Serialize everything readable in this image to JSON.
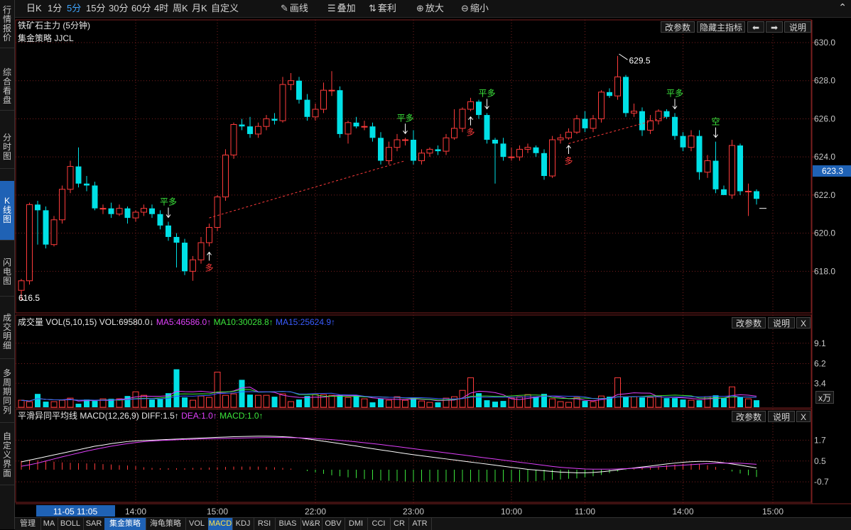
{
  "sidebar": [
    {
      "label": "行情报价",
      "top": 0,
      "h": 68,
      "active": false
    },
    {
      "label": "综合看盘",
      "top": 88,
      "h": 68,
      "active": false
    },
    {
      "label": "分时图",
      "top": 178,
      "h": 60,
      "active": false
    },
    {
      "label": "K线图",
      "top": 255,
      "h": 84,
      "active": true
    },
    {
      "label": "闪电图",
      "top": 350,
      "h": 68,
      "active": false
    },
    {
      "label": "成交明细",
      "top": 430,
      "h": 76,
      "active": false
    },
    {
      "label": "多周期同列",
      "top": 510,
      "h": 86,
      "active": false
    },
    {
      "label": "自定义界面",
      "top": 600,
      "h": 84,
      "active": false
    }
  ],
  "toolbar": {
    "periods": [
      "日K",
      "1分",
      "5分",
      "15分",
      "30分",
      "60分",
      "4时",
      "周K",
      "月K",
      "自定义"
    ],
    "selected_period": "5分",
    "tools": [
      {
        "icon": "pen-icon",
        "glyph": "✎",
        "label": "画线"
      },
      {
        "icon": "stack-icon",
        "glyph": "☰",
        "label": "叠加"
      },
      {
        "icon": "arbitrage-icon",
        "glyph": "⇅",
        "label": "套利"
      },
      {
        "icon": "zoom-in-icon",
        "glyph": "⊕",
        "label": "放大"
      },
      {
        "icon": "zoom-out-icon",
        "glyph": "⊖",
        "label": "缩小"
      }
    ]
  },
  "main_panel": {
    "title": "铁矿石主力 (5分钟)",
    "strategy": "集金策略 JJCL",
    "buttons": {
      "params": "改参数",
      "hide": "隐藏主指标",
      "left_glyph": "⬅",
      "right_glyph": "➡",
      "help": "说明"
    },
    "current_price": "623.3",
    "high_label": "629.5",
    "low_label": "616.5"
  },
  "vol_panel": {
    "title": "成交量",
    "params": "VOL(5,10,15)",
    "vol_text": "VOL:69580.0↓",
    "ma5_text": "MA5:46586.0↑",
    "ma10_text": "MA10:30028.8↑",
    "ma15_text": "MA15:25624.9↑",
    "unit": "x万",
    "buttons": {
      "params": "改参数",
      "help": "说明",
      "close": "X"
    },
    "ticks": [
      "9.1",
      "6.2",
      "3.4"
    ]
  },
  "macd_panel": {
    "title": "平滑异同平均线",
    "params": "MACD(12,26,9)",
    "diff_text": "DIFF:1.5↑",
    "dea_text": "DEA:1.0↑",
    "macd_text": "MACD:1.0↑",
    "buttons": {
      "params": "改参数",
      "help": "说明",
      "close": "X"
    },
    "ticks": [
      "1.7",
      "0.5",
      "-0.7"
    ]
  },
  "signals": [
    {
      "label": "平多",
      "index": 18,
      "kind": "buy_exit"
    },
    {
      "label": "多",
      "index": 23,
      "kind": "buy"
    },
    {
      "label": "平多",
      "index": 47,
      "kind": "buy_exit"
    },
    {
      "label": "多",
      "index": 55,
      "kind": "buy"
    },
    {
      "label": "平多",
      "index": 57,
      "kind": "buy_exit"
    },
    {
      "label": "多",
      "index": 67,
      "kind": "buy"
    },
    {
      "label": "平多",
      "index": 80,
      "kind": "buy_exit"
    },
    {
      "label": "空",
      "index": 85,
      "kind": "sell"
    }
  ],
  "colors": {
    "up": "#ff3b3b",
    "down": "#00e0e6",
    "grid": "#7a1f1f",
    "axis": "#c8c8c8",
    "ma5": "#ffffff",
    "ma10": "#ffd400",
    "ma15": "#e040fb",
    "diff": "#ffffff",
    "dea": "#e040fb",
    "macd_up": "#ff3b3b",
    "macd_down": "#3ce63c",
    "signal_green": "#3ce63c",
    "signal_red": "#ff3b3b"
  },
  "chart_data": {
    "type": "candlestick",
    "y_ticks": [
      630,
      628,
      626,
      624,
      622,
      620,
      618
    ],
    "ylim": [
      616,
      630.2
    ],
    "x_ticks": [
      {
        "i": 0,
        "label": "11-05 11:05",
        "highlight": true
      },
      {
        "i": 14,
        "label": "14:00"
      },
      {
        "i": 24,
        "label": "15:00"
      },
      {
        "i": 36,
        "label": "22:00"
      },
      {
        "i": 48,
        "label": "23:00"
      },
      {
        "i": 60,
        "label": "10:00"
      },
      {
        "i": 69,
        "label": "11:00"
      },
      {
        "i": 81,
        "label": "14:00"
      },
      {
        "i": 92,
        "label": "15:00"
      }
    ],
    "open": [
      617.0,
      617.5,
      621.5,
      621.2,
      619.4,
      620.7,
      622.3,
      623.5,
      622.6,
      622.5,
      621.3,
      621.3,
      621.0,
      621.3,
      620.8,
      621.1,
      621.3,
      621.0,
      620.4,
      619.8,
      619.5,
      618.0,
      618.6,
      619.5,
      620.3,
      621.9,
      624.1,
      625.7,
      625.6,
      625.2,
      625.6,
      626.0,
      625.9,
      627.8,
      628.0,
      627.0,
      626.1,
      626.5,
      627.5,
      627.5,
      625.2,
      625.8,
      625.6,
      625.6,
      625.0,
      623.8,
      624.5,
      624.9,
      624.9,
      623.8,
      624.2,
      624.4,
      624.3,
      625.0,
      625.5,
      626.5,
      626.9,
      626.2,
      624.9,
      624.7,
      624.0,
      624.0,
      624.4,
      624.5,
      624.2,
      623.0,
      624.9,
      625.0,
      625.3,
      626.0,
      625.5,
      626.0,
      627.4,
      627.2,
      628.2,
      626.3,
      626.4,
      625.4,
      625.9,
      626.4,
      626.1,
      625.1,
      624.5,
      625.1,
      623.2,
      623.8,
      622.3,
      622.0,
      624.6,
      622.2,
      622.2
    ],
    "close": [
      617.5,
      621.5,
      621.2,
      619.4,
      620.7,
      622.3,
      623.5,
      622.6,
      622.5,
      621.3,
      621.3,
      621.0,
      621.3,
      620.8,
      621.1,
      621.3,
      621.0,
      620.4,
      619.8,
      619.5,
      618.0,
      618.6,
      619.5,
      620.3,
      621.9,
      624.1,
      625.7,
      625.6,
      625.2,
      625.6,
      626.0,
      625.9,
      627.8,
      628.0,
      627.0,
      626.1,
      626.5,
      627.5,
      627.5,
      625.2,
      625.8,
      625.6,
      625.6,
      625.0,
      623.8,
      624.5,
      624.9,
      624.9,
      623.8,
      624.2,
      624.4,
      624.3,
      625.0,
      625.5,
      626.5,
      626.9,
      626.2,
      624.9,
      624.7,
      624.0,
      624.0,
      624.4,
      624.5,
      624.2,
      623.0,
      624.9,
      625.0,
      625.3,
      626.0,
      625.5,
      626.0,
      627.4,
      627.2,
      628.2,
      626.3,
      626.4,
      625.4,
      625.9,
      626.4,
      626.1,
      625.1,
      624.5,
      625.1,
      623.2,
      623.8,
      622.3,
      622.0,
      624.6,
      622.2,
      622.2,
      621.8
    ],
    "high": [
      617.6,
      621.6,
      621.7,
      621.4,
      620.9,
      622.5,
      623.8,
      624.5,
      623.0,
      622.7,
      621.5,
      621.6,
      621.5,
      621.4,
      621.2,
      621.5,
      621.5,
      621.2,
      620.6,
      620.0,
      619.7,
      618.8,
      619.8,
      620.5,
      622.0,
      624.4,
      625.8,
      626.0,
      626.1,
      625.8,
      626.2,
      626.3,
      628.2,
      628.4,
      628.2,
      627.3,
      626.8,
      627.9,
      628.5,
      627.7,
      625.9,
      626.1,
      625.9,
      625.8,
      625.3,
      624.8,
      625.2,
      625.0,
      625.4,
      624.4,
      624.5,
      624.6,
      625.2,
      626.5,
      626.6,
      627.1,
      627.0,
      626.3,
      625.0,
      625.0,
      624.5,
      624.6,
      624.7,
      624.6,
      624.4,
      625.1,
      625.2,
      625.5,
      626.2,
      626.4,
      626.2,
      627.5,
      627.6,
      629.3,
      628.3,
      626.8,
      626.6,
      626.2,
      626.5,
      626.5,
      626.3,
      625.3,
      625.4,
      625.4,
      624.1,
      624.8,
      622.5,
      624.9,
      624.7,
      622.6,
      622.3
    ],
    "low": [
      616.5,
      617.3,
      619.4,
      619.2,
      619.3,
      620.5,
      622.1,
      622.4,
      622.2,
      621.2,
      621.0,
      620.8,
      620.9,
      620.5,
      620.6,
      620.9,
      620.8,
      620.2,
      619.6,
      618.2,
      617.8,
      617.5,
      618.4,
      619.3,
      620.1,
      621.7,
      623.9,
      625.4,
      625.0,
      625.0,
      625.4,
      625.7,
      625.8,
      627.5,
      626.8,
      625.9,
      625.9,
      626.3,
      627.2,
      625.0,
      624.7,
      625.5,
      625.4,
      624.8,
      623.6,
      623.6,
      624.3,
      624.6,
      623.6,
      623.6,
      624.0,
      624.1,
      624.1,
      624.9,
      625.3,
      626.4,
      626.0,
      624.7,
      622.6,
      623.8,
      623.8,
      623.8,
      624.2,
      624.0,
      622.8,
      622.9,
      624.7,
      624.9,
      625.2,
      625.3,
      625.3,
      625.8,
      627.1,
      627.0,
      626.1,
      626.1,
      625.1,
      625.2,
      625.7,
      626.0,
      624.9,
      624.3,
      624.3,
      622.8,
      622.9,
      622.1,
      622.0,
      621.8,
      622.0,
      620.9,
      621.5
    ],
    "volume_x10k": [
      1.0,
      0.8,
      1.9,
      0.8,
      0.8,
      1.0,
      1.3,
      0.5,
      1.1,
      0.9,
      1.2,
      1.2,
      1.2,
      1.6,
      2.2,
      1.7,
      1.1,
      1.2,
      2.0,
      5.4,
      1.4,
      1.0,
      1.6,
      1.4,
      5.0,
      1.7,
      1.9,
      3.9,
      1.8,
      1.7,
      1.7,
      1.5,
      1.9,
      0.8,
      1.1,
      1.6,
      1.8,
      1.8,
      1.7,
      1.7,
      1.4,
      1.7,
      1.2,
      0.7,
      1.2,
      1.0,
      1.5,
      1.0,
      1.3,
      0.9,
      0.7,
      0.7,
      1.3,
      1.5,
      2.4,
      4.2,
      2.0,
      1.0,
      0.8,
      0.9,
      1.3,
      1.5,
      1.8,
      1.5,
      1.9,
      1.2,
      0.8,
      0.7,
      1.4,
      0.9,
      0.8,
      1.6,
      1.5,
      4.2,
      1.5,
      1.5,
      1.4,
      1.4,
      1.6,
      1.3,
      1.3,
      1.1,
      1.0,
      1.0,
      1.5,
      1.7,
      1.3,
      2.9,
      1.5,
      1.2,
      1.0
    ],
    "macd_diff": [
      0.45,
      0.55,
      0.65,
      0.75,
      0.85,
      0.95,
      1.05,
      1.15,
      1.25,
      1.35,
      1.42,
      1.5,
      1.56,
      1.62,
      1.66,
      1.68,
      1.7,
      1.72,
      1.74,
      1.76,
      1.78,
      1.8,
      1.82,
      1.84,
      1.86,
      1.88,
      1.9,
      1.91,
      1.92,
      1.93,
      1.93,
      1.92,
      1.9,
      1.87,
      1.83,
      1.77,
      1.71,
      1.64,
      1.57,
      1.5,
      1.43,
      1.36,
      1.28,
      1.21,
      1.14,
      1.07,
      1.0,
      0.93,
      0.86,
      0.8,
      0.74,
      0.68,
      0.62,
      0.56,
      0.5,
      0.44,
      0.38,
      0.32,
      0.26,
      0.2,
      0.14,
      0.08,
      0.02,
      -0.02,
      -0.06,
      -0.1,
      -0.14,
      -0.16,
      -0.18,
      -0.18,
      -0.16,
      -0.12,
      -0.07,
      -0.01,
      0.05,
      0.1,
      0.16,
      0.21,
      0.27,
      0.33,
      0.38,
      0.43,
      0.46,
      0.48,
      0.48,
      0.45,
      0.4,
      0.33,
      0.26,
      0.18,
      0.1
    ],
    "macd_dea": [
      0.2,
      0.28,
      0.38,
      0.5,
      0.62,
      0.74,
      0.85,
      0.96,
      1.07,
      1.17,
      1.26,
      1.35,
      1.43,
      1.5,
      1.56,
      1.61,
      1.65,
      1.68,
      1.7,
      1.72,
      1.74,
      1.75,
      1.77,
      1.78,
      1.79,
      1.8,
      1.81,
      1.82,
      1.83,
      1.84,
      1.85,
      1.85,
      1.85,
      1.84,
      1.83,
      1.81,
      1.79,
      1.76,
      1.73,
      1.69,
      1.65,
      1.6,
      1.55,
      1.5,
      1.45,
      1.39,
      1.33,
      1.27,
      1.21,
      1.15,
      1.09,
      1.03,
      0.97,
      0.91,
      0.85,
      0.79,
      0.73,
      0.67,
      0.61,
      0.55,
      0.49,
      0.43,
      0.37,
      0.31,
      0.25,
      0.19,
      0.14,
      0.1,
      0.07,
      0.04,
      0.03,
      0.03,
      0.03,
      0.04,
      0.06,
      0.08,
      0.11,
      0.14,
      0.17,
      0.2,
      0.23,
      0.26,
      0.29,
      0.32,
      0.35,
      0.37,
      0.38,
      0.38,
      0.37,
      0.34,
      0.31
    ]
  }
}
